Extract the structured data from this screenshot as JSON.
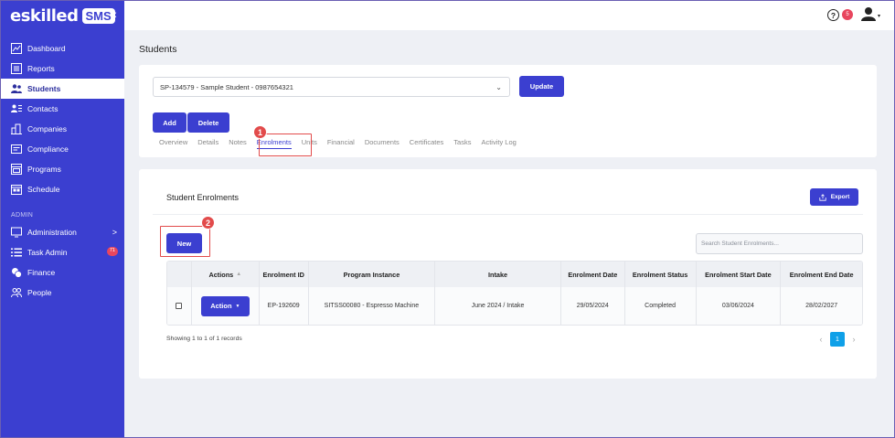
{
  "brand": {
    "name": "eskilled",
    "badge": "SMS",
    "collapse_icon": "double-chevron-left-icon"
  },
  "sidebar": {
    "items": [
      {
        "label": "Dashboard",
        "icon": "chart-line-icon"
      },
      {
        "label": "Reports",
        "icon": "report-icon"
      },
      {
        "label": "Students",
        "icon": "users-icon",
        "active": true
      },
      {
        "label": "Contacts",
        "icon": "contact-card-icon"
      },
      {
        "label": "Companies",
        "icon": "building-icon"
      },
      {
        "label": "Compliance",
        "icon": "id-card-icon"
      },
      {
        "label": "Programs",
        "icon": "window-icon"
      },
      {
        "label": "Schedule",
        "icon": "calendar-icon"
      }
    ],
    "admin_label": "ADMIN",
    "admin_items": [
      {
        "label": "Administration",
        "icon": "monitor-icon",
        "chevron": ">"
      },
      {
        "label": "Task Admin",
        "icon": "list-icon",
        "count": "71"
      },
      {
        "label": "Finance",
        "icon": "coins-icon"
      },
      {
        "label": "People",
        "icon": "people-icon"
      }
    ]
  },
  "topbar": {
    "help": "?",
    "notifications": "5",
    "user_caret": "▾"
  },
  "page": {
    "title": "Students"
  },
  "student_select": {
    "value": "SP-134579 - Sample Student - 0987654321",
    "chevron": "⌄"
  },
  "buttons": {
    "update": "Update",
    "add": "Add",
    "delete": "Delete",
    "export": "Export",
    "new": "New"
  },
  "tabs": [
    "Overview",
    "Details",
    "Notes",
    "Enrolments",
    "Units",
    "Financial",
    "Documents",
    "Certificates",
    "Tasks",
    "Activity Log"
  ],
  "active_tab": "Enrolments",
  "annotations": {
    "step1": "1",
    "step2": "2"
  },
  "enrolments": {
    "title": "Student Enrolments",
    "search_placeholder": "Search Student Enrolments...",
    "columns": [
      "",
      "Actions",
      "Enrolment ID",
      "Program Instance",
      "Intake",
      "Enrolment Date",
      "Enrolment Status",
      "Enrolment Start Date",
      "Enrolment End Date"
    ],
    "rows": [
      {
        "action": "Action",
        "id": "EP-192609",
        "program": "SITSS00080 - Espresso Machine",
        "intake": "June 2024 / Intake",
        "date": "29/05/2024",
        "status": "Completed",
        "start": "03/06/2024",
        "end": "28/02/2027"
      }
    ],
    "footer": "Showing 1 to 1 of 1 records",
    "pagination": {
      "prev": "‹",
      "current": "1",
      "next": "›"
    }
  },
  "colors": {
    "primary": "#3b3fd0",
    "highlight": "#e24b4b",
    "badge": "#e8465e",
    "page_active": "#0fa0e8"
  }
}
